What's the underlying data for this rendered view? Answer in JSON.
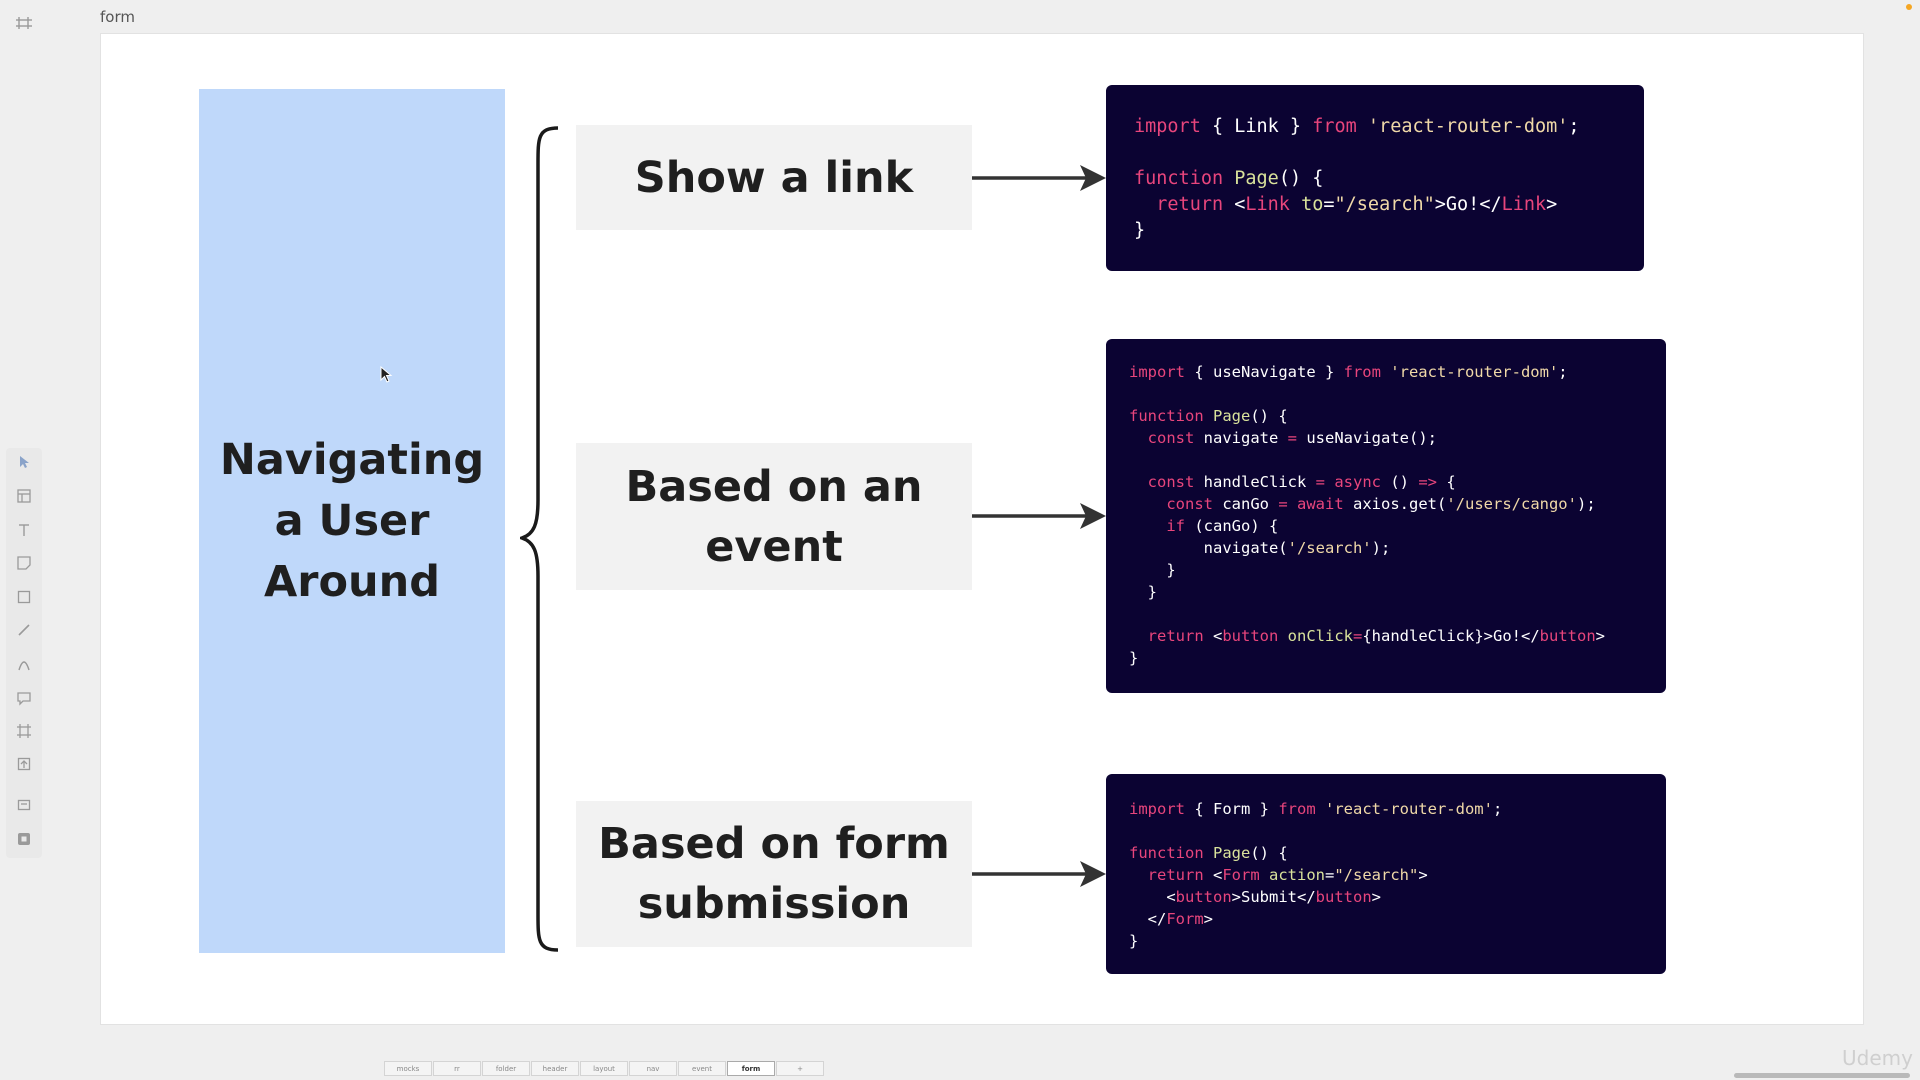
{
  "frame_title": "form",
  "main_title_lines": [
    "Navigating",
    "a User",
    "Around"
  ],
  "labels": {
    "link": "Show a link",
    "event": "Based on an event",
    "form": "Based on form submission"
  },
  "code": {
    "link": [
      [
        [
          "k",
          "import"
        ],
        [
          "p",
          " { Link } "
        ],
        [
          "k",
          "from"
        ],
        [
          "s",
          " 'react-router-dom'"
        ],
        [
          "p",
          ";"
        ]
      ],
      [],
      [
        [
          "k",
          "function"
        ],
        [
          "f",
          " Page"
        ],
        [
          "p",
          "() {"
        ]
      ],
      [
        [
          "p",
          "  "
        ],
        [
          "k",
          "return"
        ],
        [
          "p",
          " <"
        ],
        [
          "t",
          "Link"
        ],
        [
          "a",
          " to"
        ],
        [
          "p",
          "="
        ],
        [
          "s",
          "\"/search\""
        ],
        [
          "p",
          ">Go!</"
        ],
        [
          "t",
          "Link"
        ],
        [
          "p",
          ">"
        ]
      ],
      [
        [
          "p",
          "}"
        ]
      ]
    ],
    "event": [
      [
        [
          "k",
          "import"
        ],
        [
          "p",
          " { useNavigate } "
        ],
        [
          "k",
          "from"
        ],
        [
          "s",
          " 'react-router-dom'"
        ],
        [
          "p",
          ";"
        ]
      ],
      [],
      [
        [
          "k",
          "function"
        ],
        [
          "f",
          " Page"
        ],
        [
          "p",
          "() {"
        ]
      ],
      [
        [
          "p",
          "  "
        ],
        [
          "k",
          "const"
        ],
        [
          "p",
          " navigate "
        ],
        [
          "k",
          "="
        ],
        [
          "p",
          " useNavigate();"
        ]
      ],
      [],
      [
        [
          "p",
          "  "
        ],
        [
          "k",
          "const"
        ],
        [
          "p",
          " handleClick "
        ],
        [
          "k",
          "="
        ],
        [
          "k",
          " async"
        ],
        [
          "p",
          " () "
        ],
        [
          "k",
          "=>"
        ],
        [
          "p",
          " {"
        ]
      ],
      [
        [
          "p",
          "    "
        ],
        [
          "k",
          "const"
        ],
        [
          "p",
          " canGo "
        ],
        [
          "k",
          "="
        ],
        [
          "k",
          " await"
        ],
        [
          "p",
          " axios.get("
        ],
        [
          "s",
          "'/users/cango'"
        ],
        [
          "p",
          ");"
        ]
      ],
      [
        [
          "p",
          "    "
        ],
        [
          "k",
          "if"
        ],
        [
          "p",
          " (canGo) {"
        ]
      ],
      [
        [
          "p",
          "        navigate("
        ],
        [
          "s",
          "'/search'"
        ],
        [
          "p",
          ");"
        ]
      ],
      [
        [
          "p",
          "    }"
        ]
      ],
      [
        [
          "p",
          "  }"
        ]
      ],
      [],
      [
        [
          "p",
          "  "
        ],
        [
          "k",
          "return"
        ],
        [
          "p",
          " <"
        ],
        [
          "t",
          "button"
        ],
        [
          "a",
          " onClick"
        ],
        [
          "k",
          "="
        ],
        [
          "p",
          "{handleClick}>Go!</"
        ],
        [
          "t",
          "button"
        ],
        [
          "p",
          ">"
        ]
      ],
      [
        [
          "p",
          "}"
        ]
      ]
    ],
    "form": [
      [
        [
          "k",
          "import"
        ],
        [
          "p",
          " { Form } "
        ],
        [
          "k",
          "from"
        ],
        [
          "s",
          " 'react-router-dom'"
        ],
        [
          "p",
          ";"
        ]
      ],
      [],
      [
        [
          "k",
          "function"
        ],
        [
          "f",
          " Page"
        ],
        [
          "p",
          "() {"
        ]
      ],
      [
        [
          "p",
          "  "
        ],
        [
          "k",
          "return"
        ],
        [
          "p",
          " <"
        ],
        [
          "t",
          "Form"
        ],
        [
          "a",
          " action"
        ],
        [
          "p",
          "="
        ],
        [
          "s",
          "\"/search\""
        ],
        [
          "p",
          ">"
        ]
      ],
      [
        [
          "p",
          "    <"
        ],
        [
          "t",
          "button"
        ],
        [
          "p",
          ">Submit</"
        ],
        [
          "t",
          "button"
        ],
        [
          "p",
          ">"
        ]
      ],
      [
        [
          "p",
          "  </"
        ],
        [
          "t",
          "Form"
        ],
        [
          "p",
          ">"
        ]
      ],
      [
        [
          "p",
          "}"
        ]
      ]
    ]
  },
  "tabs": [
    {
      "label": "mocks",
      "active": false
    },
    {
      "label": "rr",
      "active": false
    },
    {
      "label": "folder",
      "active": false
    },
    {
      "label": "header",
      "active": false
    },
    {
      "label": "layout",
      "active": false
    },
    {
      "label": "nav",
      "active": false
    },
    {
      "label": "event",
      "active": false
    },
    {
      "label": "form",
      "active": true
    },
    {
      "label": "+",
      "active": false
    }
  ],
  "tools": [
    "pointer-icon",
    "layout-icon",
    "text-icon",
    "sticky-note-icon",
    "rectangle-icon",
    "pen-icon",
    "path-icon",
    "comment-icon",
    "frame-icon",
    "upload-icon",
    "embed-icon",
    "plugin-icon"
  ],
  "watermark": "Udemy",
  "colors": {
    "canvas_bg": "#efefef",
    "panel_blue": "#bfd8fa",
    "label_box": "#f2f2f2",
    "code_bg": "#0b0332",
    "code_keyword": "#e8457c",
    "code_function": "#d9e29b",
    "code_string": "#f0d9a8"
  }
}
